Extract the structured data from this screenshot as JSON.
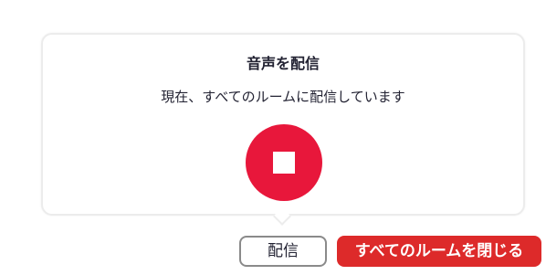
{
  "popover": {
    "title": "音声を配信",
    "message": "現在、すべてのルームに配信しています",
    "stop_icon": "stop-icon",
    "accent_color": "#e8173b"
  },
  "footer": {
    "broadcast_label": "配信",
    "close_all_label": "すべてのルームを閉じる",
    "close_all_color": "#dd2a2a"
  }
}
